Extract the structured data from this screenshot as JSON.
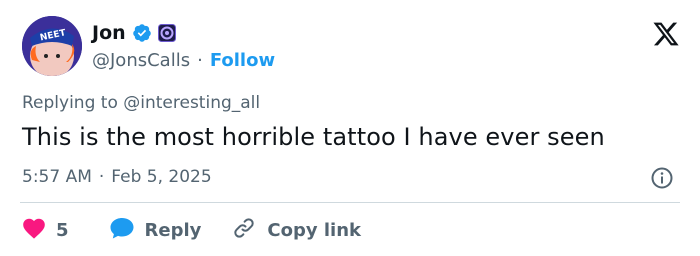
{
  "author": {
    "name": "Jon",
    "handle": "@JonsCalls",
    "separator": "·",
    "follow_label": "Follow",
    "avatar_text": "NEET"
  },
  "tweet": {
    "reply_prefix": "Replying to ",
    "reply_to": "@interesting_all",
    "text": "This is the most horrible tattoo I have ever seen",
    "time": "5:57 AM",
    "date": "Feb 5, 2025",
    "meta_separator": "·"
  },
  "actions": {
    "like_count": "5",
    "reply_label": "Reply",
    "copy_label": "Copy link"
  },
  "colors": {
    "accent": "#1d9bf0",
    "like": "#f91880",
    "muted": "#536471",
    "text": "#0f1419"
  }
}
